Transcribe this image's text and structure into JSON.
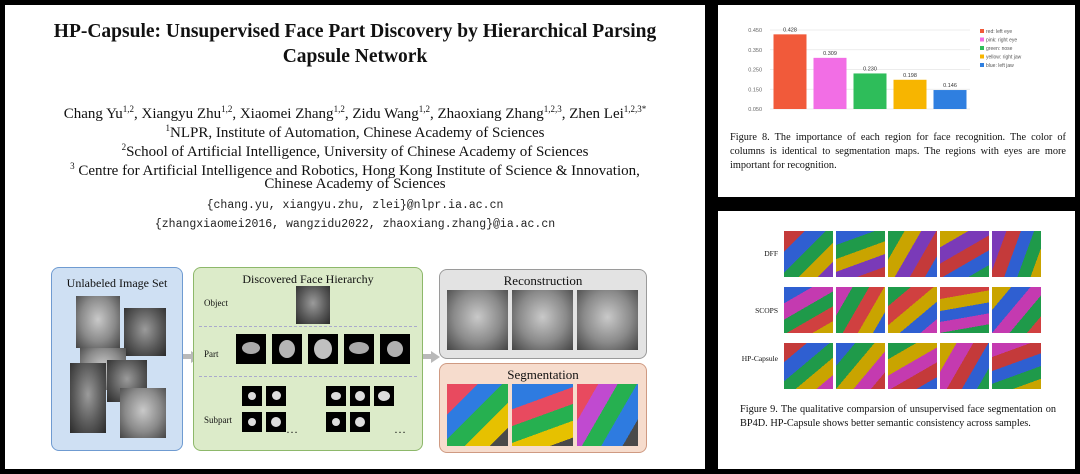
{
  "paper": {
    "title_line1": "HP-Capsule: Unsupervised Face Part Discovery by Hierarchical Parsing",
    "title_line2": "Capsule Network",
    "authors": [
      {
        "name": "Chang Yu",
        "aff": "1,2"
      },
      {
        "name": "Xiangyu Zhu",
        "aff": "1,2"
      },
      {
        "name": "Xiaomei Zhang",
        "aff": "1,2"
      },
      {
        "name": "Zidu Wang",
        "aff": "1,2"
      },
      {
        "name": "Zhaoxiang Zhang",
        "aff": "1,2,3"
      },
      {
        "name": "Zhen Lei",
        "aff": "1,2,3*"
      }
    ],
    "affiliations": [
      {
        "num": "1",
        "text": "NLPR, Institute of Automation, Chinese Academy of Sciences"
      },
      {
        "num": "2",
        "text": "School of Artificial Intelligence, University of Chinese Academy of Sciences"
      },
      {
        "num": "3",
        "text": "Centre for Artificial Intelligence and Robotics, Hong Kong Institute of Science & Innovation,"
      }
    ],
    "affil3_line2": "Chinese Academy of Sciences",
    "email1": "{chang.yu, xiangyu.zhu, zlei}@nlpr.ia.ac.cn",
    "email2": "{zhangxiaomei2016, wangzidu2022, zhaoxiang.zhang}@ia.ac.cn"
  },
  "diagram": {
    "unlabeled_title": "Unlabeled Image Set",
    "hierarchy_title": "Discovered Face Hierarchy",
    "row_object": "Object",
    "row_part": "Part",
    "row_subpart": "Subpart",
    "ellipsis": "…",
    "reconstruction_title": "Reconstruction",
    "segmentation_title": "Segmentation"
  },
  "fig8": {
    "caption": "Figure 8. The importance of each region for face recognition. The color of columns is identical to segmentation maps. The regions with eyes are more important for recognition."
  },
  "fig9": {
    "caption": "Figure 9.   The qualitative comparsion of unsupervised face segmentation on BP4D. HP-Capsule shows better semantic consistency across samples.",
    "rows": [
      "DFF",
      "SCOPS",
      "HP-Capsule"
    ]
  },
  "chart_data": {
    "type": "bar",
    "categories": [
      "red: left eye",
      "pink: right eye",
      "green: nose",
      "yellow: right jaw",
      "blue: left jaw"
    ],
    "values": [
      0.428,
      0.309,
      0.23,
      0.198,
      0.146
    ],
    "value_labels": [
      "0.428",
      "0.309",
      "0.230",
      "0.198",
      "0.146"
    ],
    "legend": [
      "red: left eye",
      "pink: right eye",
      "green: nose",
      "yellow: right jaw",
      "blue: left jaw"
    ],
    "legend_placement": "top-right",
    "colors": [
      "#f15a3a",
      "#f26ee5",
      "#2ebd5a",
      "#f7b500",
      "#2f7fe0"
    ],
    "yticks": [
      "0.450",
      "0.350",
      "0.250",
      "0.150",
      "0.050"
    ],
    "ylim": [
      0.05,
      0.45
    ],
    "grid": true,
    "title": "",
    "xlabel": "",
    "ylabel": ""
  }
}
